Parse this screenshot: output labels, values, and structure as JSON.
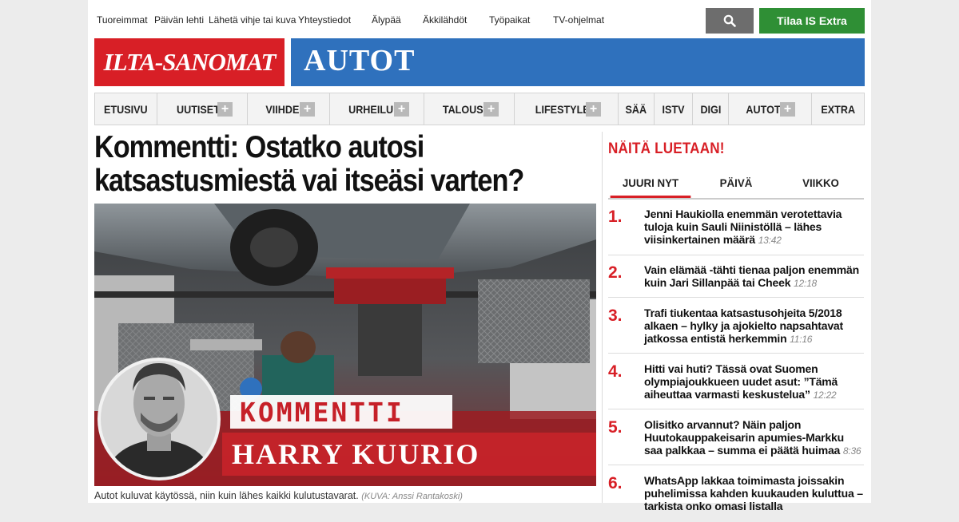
{
  "top_links": [
    "Tuoreimmat",
    "Päivän lehti",
    "Lähetä vihje tai kuva",
    "Yhteystiedot",
    "Älypää",
    "Äkkilähdöt",
    "Työpaikat",
    "TV-ohjelmat"
  ],
  "search": {
    "icon": "search-icon"
  },
  "subscribe_label": "Tilaa IS Extra",
  "brand": {
    "logo_text": "ILTA-SANOMAT",
    "logo_color": "#d81f26",
    "section": "AUTOT",
    "section_color": "#2f71bd"
  },
  "nav": [
    {
      "label": "ETUSIVU",
      "has_plus": false
    },
    {
      "label": "UUTISET",
      "has_plus": true
    },
    {
      "label": "VIIHDE",
      "has_plus": true
    },
    {
      "label": "URHEILU",
      "has_plus": true
    },
    {
      "label": "TALOUS",
      "has_plus": true
    },
    {
      "label": "LIFESTYLE",
      "has_plus": true
    },
    {
      "label": "SÄÄ",
      "has_plus": false
    },
    {
      "label": "ISTV",
      "has_plus": false
    },
    {
      "label": "DIGI",
      "has_plus": false
    },
    {
      "label": "AUTOT",
      "has_plus": true
    },
    {
      "label": "EXTRA",
      "has_plus": false
    }
  ],
  "nav_plus_symbol": "+",
  "article": {
    "headline_line1": "Kommentti: Ostatko autosi",
    "headline_line2": "katsastusmiestä vai itseäsi varten?",
    "image": {
      "banner_label": "KOMMENTTI",
      "author": "HARRY KUURIO"
    },
    "caption": "Autot kuluvat käytössä, niin kuin lähes kaikki kulutustavarat.",
    "credit": "(KUVA: Anssi Rantakoski)"
  },
  "sidebar": {
    "title": "NÄITÄ LUETAAN!",
    "tabs": [
      "JUURI NYT",
      "PÄIVÄ",
      "VIIKKO"
    ],
    "active_tab": "JUURI NYT",
    "items": [
      {
        "num": "1.",
        "text": "Jenni Haukiolla enemmän verotettavia tuloja kuin Sauli Niinistöllä – lähes viisinkertainen määrä",
        "time": "13:42"
      },
      {
        "num": "2.",
        "text": "Vain elämää -tähti tienaa paljon enemmän kuin Jari Sillanpää tai Cheek",
        "time": "12:18"
      },
      {
        "num": "3.",
        "text": "Trafi tiukentaa katsastusohjeita 5/2018 alkaen – hylky ja ajokielto napsahtavat jatkossa entistä herkemmin",
        "time": "11:16"
      },
      {
        "num": "4.",
        "text": "Hitti vai huti? Tässä ovat Suomen olympiajoukkueen uudet asut: ”Tämä aiheuttaa varmasti keskustelua”",
        "time": "12:22"
      },
      {
        "num": "5.",
        "text": "Olisitko arvannut? Näin paljon Huutokauppakeisarin apumies-Markku saa palkkaa – summa ei päätä huimaa",
        "time": "8:36"
      },
      {
        "num": "6.",
        "text": "WhatsApp lakkaa toimimasta joissakin puhelimissa kahden kuukauden kuluttua – tarkista onko omasi listalla",
        "time": ""
      }
    ]
  }
}
